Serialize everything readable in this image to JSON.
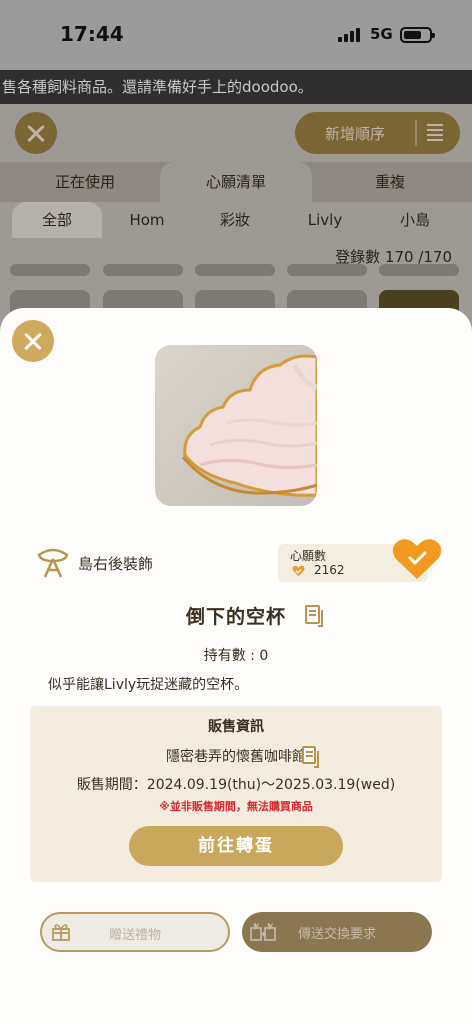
{
  "status_bar": {
    "time": "17:44",
    "network": "5G"
  },
  "marquee": {
    "text": "售各種飼料商品。還請準備好手上的doodoo。"
  },
  "background": {
    "add_order_label": "新增順序",
    "tabs": [
      "正在使用",
      "心願清單",
      "重複"
    ],
    "subtabs": [
      "全部",
      "Hom",
      "彩妝",
      "Livly",
      "小島"
    ],
    "registered_label": "登錄數",
    "registered_count": "170 /170"
  },
  "item": {
    "designer": "島右後裝飾",
    "wish_label": "心願數",
    "wish_count": "2162",
    "name": "倒下的空杯",
    "owned": "持有數 : 0",
    "description": "似乎能讓Livly玩捉迷藏的空杯。"
  },
  "sale": {
    "title": "販售資訊",
    "shop": "隱密巷弄的懷舊咖啡館",
    "period": "販售期間：2024.09.19(thu)〜2025.03.19(wed)",
    "warning": "※並非販售期間，無法購買商品",
    "gacha_button": "前往轉蛋"
  },
  "actions": {
    "gift_label": "贈送禮物",
    "trade_label": "傳送交換要求"
  },
  "colors": {
    "gold": "#cfa95e",
    "button_gold": "#c9a75c",
    "warning_red": "#d6292b",
    "heart_orange": "#f29a1f"
  }
}
